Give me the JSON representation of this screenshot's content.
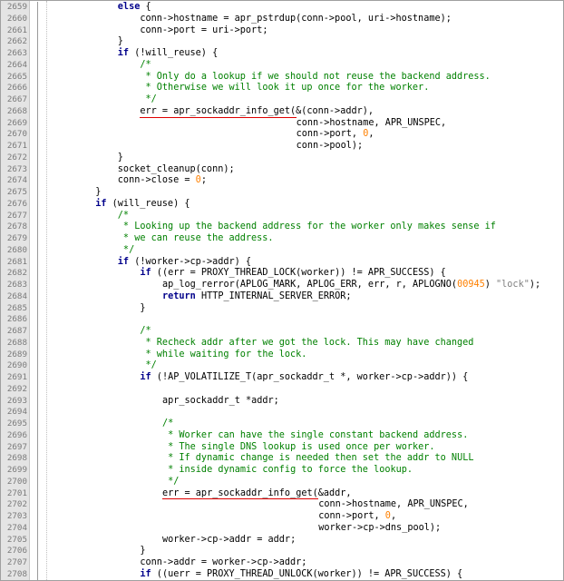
{
  "editor": {
    "colors": {
      "keyword": "#00008b",
      "comment": "#008000",
      "number": "#ff8000",
      "string": "#808080",
      "underline": "#e00000"
    },
    "lines": [
      {
        "n": "2659",
        "indent": 12,
        "tokens": [
          [
            "kw",
            "else"
          ],
          [
            "op",
            " {"
          ]
        ]
      },
      {
        "n": "2660",
        "indent": 16,
        "tokens": [
          [
            "op",
            "conn->hostname = apr_pstrdup(conn->pool, uri->hostname);"
          ]
        ]
      },
      {
        "n": "2661",
        "indent": 16,
        "tokens": [
          [
            "op",
            "conn->port = uri->port;"
          ]
        ]
      },
      {
        "n": "2662",
        "indent": 12,
        "tokens": [
          [
            "op",
            "}"
          ]
        ]
      },
      {
        "n": "2663",
        "indent": 12,
        "tokens": [
          [
            "kw",
            "if"
          ],
          [
            "op",
            " (!will_reuse) {"
          ]
        ]
      },
      {
        "n": "2664",
        "indent": 16,
        "tokens": [
          [
            "cm",
            "/*"
          ]
        ]
      },
      {
        "n": "2665",
        "indent": 16,
        "tokens": [
          [
            "cm",
            " * Only do a lookup if we should not reuse the backend address."
          ]
        ]
      },
      {
        "n": "2666",
        "indent": 16,
        "tokens": [
          [
            "cm",
            " * Otherwise we will look it up once for the worker."
          ]
        ]
      },
      {
        "n": "2667",
        "indent": 16,
        "tokens": [
          [
            "cm",
            " */"
          ]
        ]
      },
      {
        "n": "2668",
        "indent": 16,
        "tokens": [
          [
            "op",
            "err = apr_sockaddr_info_get(&(conn->addr),"
          ]
        ]
      },
      {
        "n": "2669",
        "indent": 44,
        "tokens": [
          [
            "op",
            "conn->hostname, APR_UNSPEC,"
          ]
        ]
      },
      {
        "n": "2670",
        "indent": 44,
        "tokens": [
          [
            "op",
            "conn->port, "
          ],
          [
            "num",
            "0"
          ],
          [
            "op",
            ","
          ]
        ]
      },
      {
        "n": "2671",
        "indent": 44,
        "tokens": [
          [
            "op",
            "conn->pool);"
          ]
        ]
      },
      {
        "n": "2672",
        "indent": 12,
        "tokens": [
          [
            "op",
            "}"
          ]
        ]
      },
      {
        "n": "2673",
        "indent": 12,
        "tokens": [
          [
            "op",
            "socket_cleanup(conn);"
          ]
        ]
      },
      {
        "n": "2674",
        "indent": 12,
        "tokens": [
          [
            "op",
            "conn->close = "
          ],
          [
            "num",
            "0"
          ],
          [
            "op",
            ";"
          ]
        ]
      },
      {
        "n": "2675",
        "indent": 8,
        "tokens": [
          [
            "op",
            "}"
          ]
        ]
      },
      {
        "n": "2676",
        "indent": 8,
        "tokens": [
          [
            "kw",
            "if"
          ],
          [
            "op",
            " (will_reuse) {"
          ]
        ]
      },
      {
        "n": "2677",
        "indent": 12,
        "tokens": [
          [
            "cm",
            "/*"
          ]
        ]
      },
      {
        "n": "2678",
        "indent": 12,
        "tokens": [
          [
            "cm",
            " * Looking up the backend address for the worker only makes sense if"
          ]
        ]
      },
      {
        "n": "2679",
        "indent": 12,
        "tokens": [
          [
            "cm",
            " * we can reuse the address."
          ]
        ]
      },
      {
        "n": "2680",
        "indent": 12,
        "tokens": [
          [
            "cm",
            " */"
          ]
        ]
      },
      {
        "n": "2681",
        "indent": 12,
        "tokens": [
          [
            "kw",
            "if"
          ],
          [
            "op",
            " (!worker->cp->addr) {"
          ]
        ]
      },
      {
        "n": "2682",
        "indent": 16,
        "tokens": [
          [
            "kw",
            "if"
          ],
          [
            "op",
            " ((err = PROXY_THREAD_LOCK(worker)) != APR_SUCCESS) {"
          ]
        ]
      },
      {
        "n": "2683",
        "indent": 20,
        "tokens": [
          [
            "op",
            "ap_log_rerror(APLOG_MARK, APLOG_ERR, err, r, APLOGNO("
          ],
          [
            "num",
            "00945"
          ],
          [
            "op",
            ") "
          ],
          [
            "str",
            "\"lock\""
          ],
          [
            "op",
            ");"
          ]
        ]
      },
      {
        "n": "2684",
        "indent": 20,
        "tokens": [
          [
            "kw",
            "return"
          ],
          [
            "op",
            " HTTP_INTERNAL_SERVER_ERROR;"
          ]
        ]
      },
      {
        "n": "2685",
        "indent": 16,
        "tokens": [
          [
            "op",
            "}"
          ]
        ]
      },
      {
        "n": "2686",
        "indent": 0,
        "tokens": []
      },
      {
        "n": "2687",
        "indent": 16,
        "tokens": [
          [
            "cm",
            "/*"
          ]
        ]
      },
      {
        "n": "2688",
        "indent": 16,
        "tokens": [
          [
            "cm",
            " * Recheck addr after we got the lock. This may have changed"
          ]
        ]
      },
      {
        "n": "2689",
        "indent": 16,
        "tokens": [
          [
            "cm",
            " * while waiting for the lock."
          ]
        ]
      },
      {
        "n": "2690",
        "indent": 16,
        "tokens": [
          [
            "cm",
            " */"
          ]
        ]
      },
      {
        "n": "2691",
        "indent": 16,
        "tokens": [
          [
            "kw",
            "if"
          ],
          [
            "op",
            " (!AP_VOLATILIZE_T(apr_sockaddr_t *, worker->cp->addr)) {"
          ]
        ]
      },
      {
        "n": "2692",
        "indent": 0,
        "tokens": []
      },
      {
        "n": "2693",
        "indent": 20,
        "tokens": [
          [
            "op",
            "apr_sockaddr_t *addr;"
          ]
        ]
      },
      {
        "n": "2694",
        "indent": 0,
        "tokens": []
      },
      {
        "n": "2695",
        "indent": 20,
        "tokens": [
          [
            "cm",
            "/*"
          ]
        ]
      },
      {
        "n": "2696",
        "indent": 20,
        "tokens": [
          [
            "cm",
            " * Worker can have the single constant backend address."
          ]
        ]
      },
      {
        "n": "2697",
        "indent": 20,
        "tokens": [
          [
            "cm",
            " * The single DNS lookup is used once per worker."
          ]
        ]
      },
      {
        "n": "2698",
        "indent": 20,
        "tokens": [
          [
            "cm",
            " * If dynamic change is needed then set the addr to NULL"
          ]
        ]
      },
      {
        "n": "2699",
        "indent": 20,
        "tokens": [
          [
            "cm",
            " * inside dynamic config to force the lookup."
          ]
        ]
      },
      {
        "n": "2700",
        "indent": 20,
        "tokens": [
          [
            "cm",
            " */"
          ]
        ]
      },
      {
        "n": "2701",
        "indent": 20,
        "tokens": [
          [
            "op",
            "err = apr_sockaddr_info_get(&addr,"
          ]
        ]
      },
      {
        "n": "2702",
        "indent": 48,
        "tokens": [
          [
            "op",
            "conn->hostname, APR_UNSPEC,"
          ]
        ]
      },
      {
        "n": "2703",
        "indent": 48,
        "tokens": [
          [
            "op",
            "conn->port, "
          ],
          [
            "num",
            "0"
          ],
          [
            "op",
            ","
          ]
        ]
      },
      {
        "n": "2704",
        "indent": 48,
        "tokens": [
          [
            "op",
            "worker->cp->dns_pool);"
          ]
        ]
      },
      {
        "n": "2705",
        "indent": 20,
        "tokens": [
          [
            "op",
            "worker->cp->addr = addr;"
          ]
        ]
      },
      {
        "n": "2706",
        "indent": 16,
        "tokens": [
          [
            "op",
            "}"
          ]
        ]
      },
      {
        "n": "2707",
        "indent": 16,
        "tokens": [
          [
            "op",
            "conn->addr = worker->cp->addr;"
          ]
        ]
      },
      {
        "n": "2708",
        "indent": 16,
        "tokens": [
          [
            "kw",
            "if"
          ],
          [
            "op",
            " ((uerr = PROXY_THREAD_UNLOCK(worker)) != APR_SUCCESS) {"
          ]
        ]
      }
    ]
  }
}
